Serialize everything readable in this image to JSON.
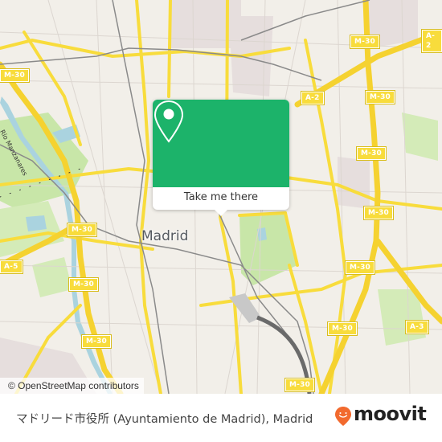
{
  "map": {
    "city_label": "Madrid",
    "river_label": "Río Manzanares",
    "attribution": "© OpenStreetMap contributors",
    "colors": {
      "background": "#f2efe9",
      "motorway": "#f8dc3c",
      "park": "#c8e6a8",
      "water": "#aad3df",
      "rail": "#8a8a8a",
      "urban": "#e6dedd"
    },
    "road_shields": [
      {
        "label": "M-30",
        "id": "m30-nw"
      },
      {
        "label": "M-30",
        "id": "m30-ne-top"
      },
      {
        "label": "A-2",
        "id": "a2-ne"
      },
      {
        "label": "A-2",
        "id": "a2-center"
      },
      {
        "label": "M-30",
        "id": "m30-ne-2"
      },
      {
        "label": "M-30",
        "id": "m30-e-1"
      },
      {
        "label": "M-30",
        "id": "m30-e-2"
      },
      {
        "label": "M-30",
        "id": "m30-e-3"
      },
      {
        "label": "M-30",
        "id": "m30-se"
      },
      {
        "label": "A-3",
        "id": "a3"
      },
      {
        "label": "M-30",
        "id": "m30-w-1"
      },
      {
        "label": "A-5",
        "id": "a5"
      },
      {
        "label": "M-30",
        "id": "m30-w-2"
      },
      {
        "label": "M-30",
        "id": "m30-sw"
      },
      {
        "label": "M-30",
        "id": "m30-s"
      }
    ]
  },
  "popup": {
    "icon": "location-pin-icon",
    "button_label": "Take me there",
    "color": "#1cb36a"
  },
  "footer": {
    "place_text": "マドリード市役所 (Ayuntamiento de Madrid), Madrid",
    "brand": "moovit",
    "brand_color": "#f26a2e"
  }
}
